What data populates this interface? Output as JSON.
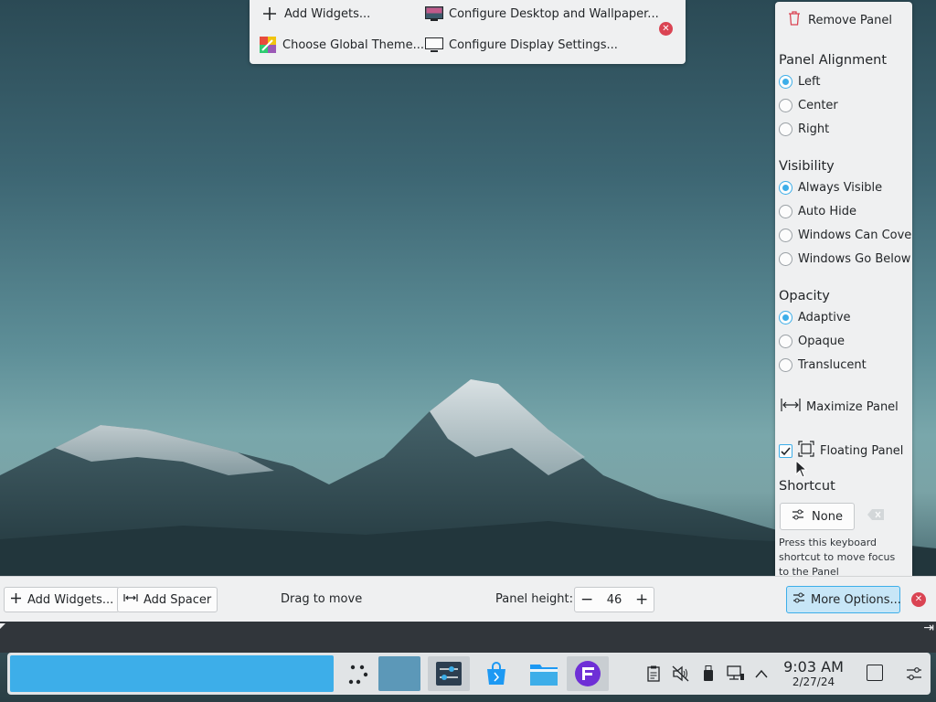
{
  "top_toolbar": {
    "add_widgets": "Add Widgets...",
    "configure_desktop": "Configure Desktop and Wallpaper...",
    "global_theme": "Choose Global Theme...",
    "display_settings": "Configure Display Settings..."
  },
  "side_panel": {
    "remove_panel": "Remove Panel",
    "alignment": {
      "title": "Panel Alignment",
      "options": [
        "Left",
        "Center",
        "Right"
      ],
      "selected": "Left"
    },
    "visibility": {
      "title": "Visibility",
      "options": [
        "Always Visible",
        "Auto Hide",
        "Windows Can Cover",
        "Windows Go Below"
      ],
      "selected": "Always Visible"
    },
    "opacity": {
      "title": "Opacity",
      "options": [
        "Adaptive",
        "Opaque",
        "Translucent"
      ],
      "selected": "Adaptive"
    },
    "maximize": "Maximize Panel",
    "floating": "Floating Panel",
    "floating_checked": true,
    "shortcut": {
      "title": "Shortcut",
      "button": "None",
      "hint": "Press this keyboard shortcut to move focus to the Panel"
    }
  },
  "edit_bar": {
    "add_widgets": "Add Widgets...",
    "add_spacer": "Add Spacer",
    "drag_to_move": "Drag to move",
    "panel_height_label": "Panel height:",
    "panel_height_value": "46",
    "more_options": "More Options..."
  },
  "taskbar": {
    "time": "9:03 AM",
    "date": "2/27/24"
  },
  "colors": {
    "accent": "#3daee9",
    "close_red": "#da4453",
    "panel_bg": "#eff0f1"
  }
}
